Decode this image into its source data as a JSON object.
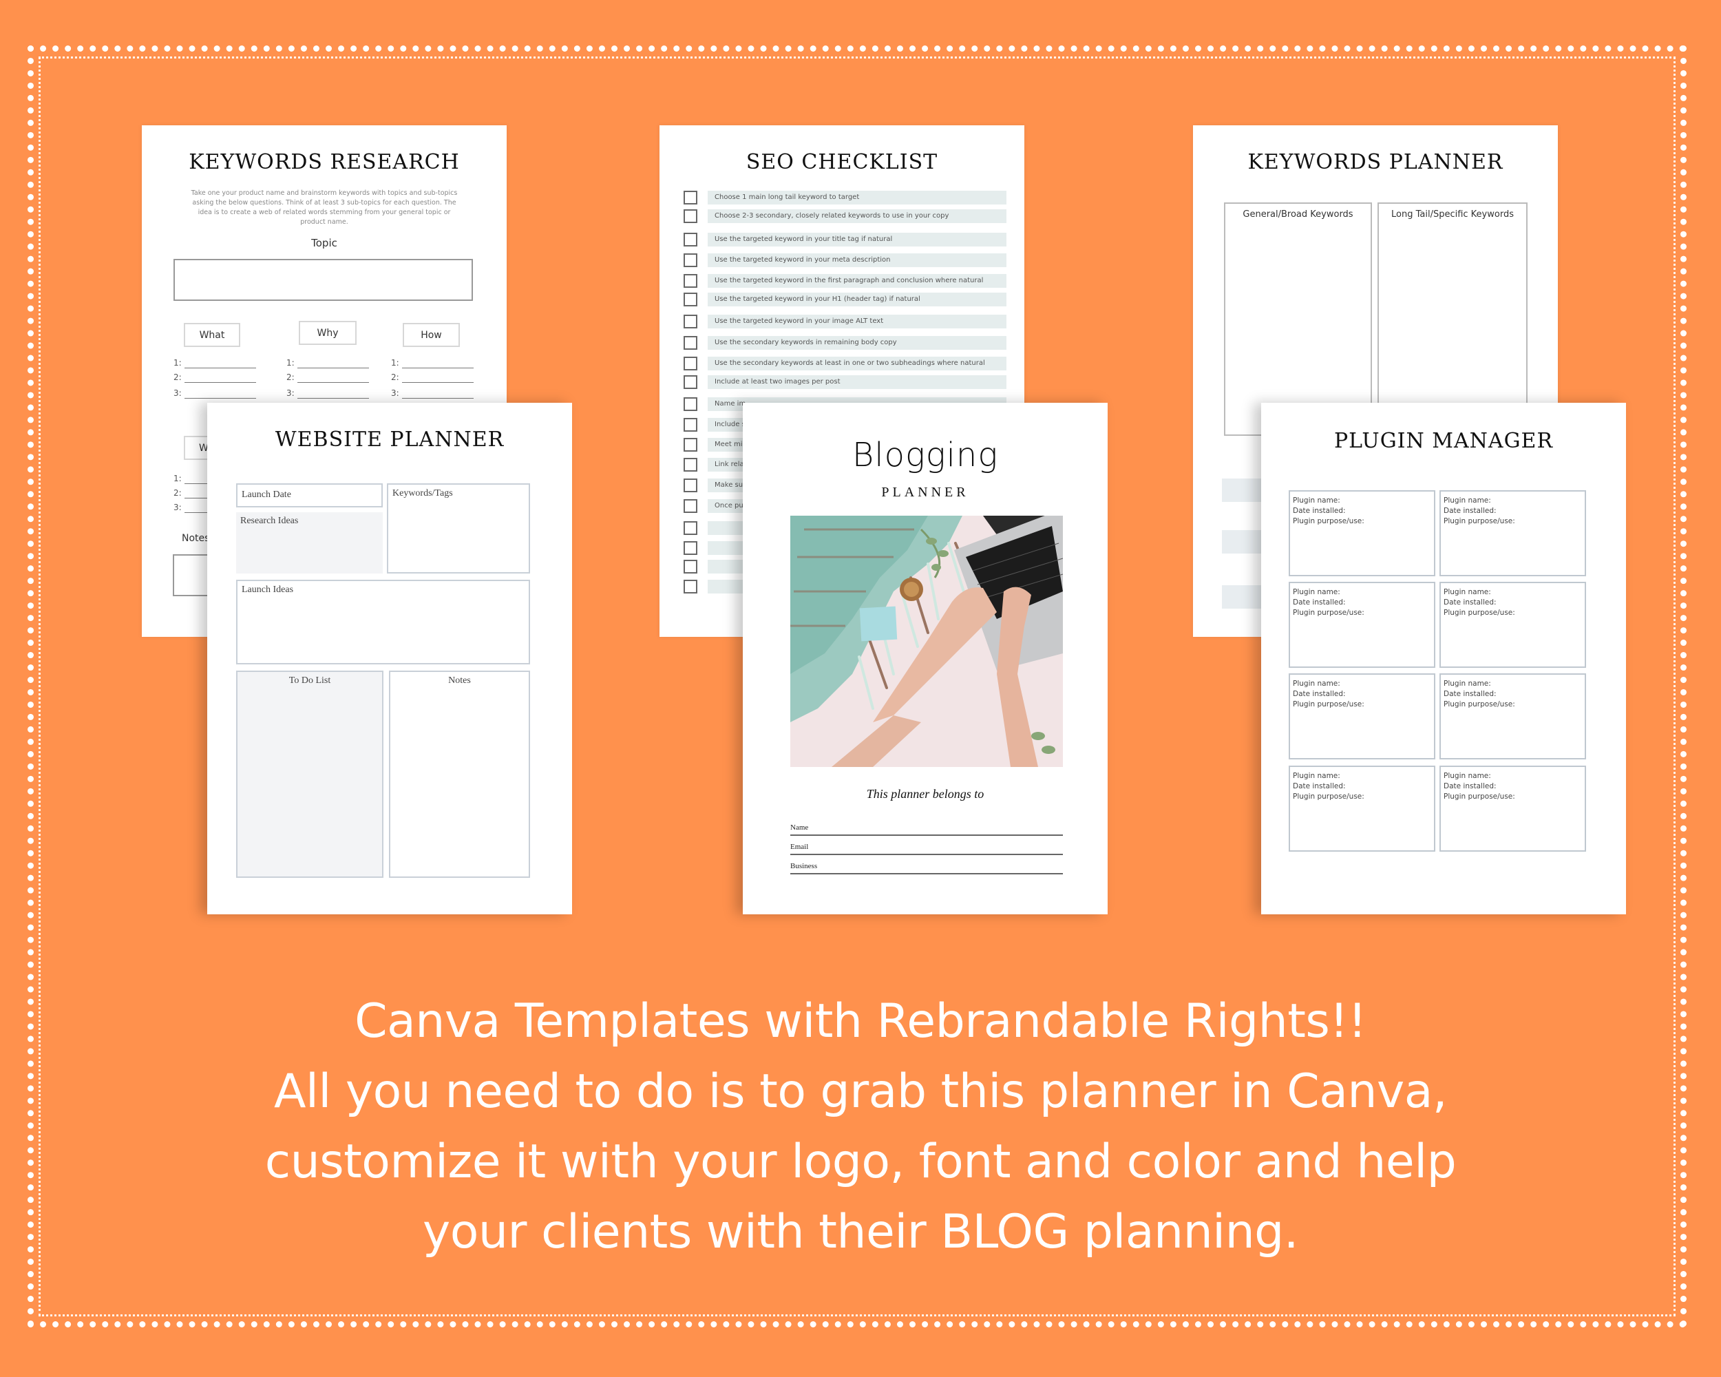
{
  "colors": {
    "background": "#ff914d",
    "page": "#ffffff",
    "checklist_bar": "#e5eded",
    "box_border": "#c9d0d8",
    "gray_fill": "#f3f4f6",
    "border_dots": "#ffffff"
  },
  "keywords_research": {
    "title": "KEYWORDS RESEARCH",
    "intro": "Take one your product name and brainstorm keywords with topics and sub-topics asking the below questions. Think of at least 3 sub-topics for each question. The idea is to create a web of related words stemming from your general topic or product name.",
    "topic_label": "Topic",
    "questions": [
      "What",
      "Why",
      "How"
    ],
    "second_row_partial": "W",
    "line_numbers": [
      "1:",
      "2:",
      "3:"
    ],
    "notes_label": "Notes"
  },
  "seo_checklist": {
    "title": "SEO CHECKLIST",
    "items": [
      "Choose 1 main long tail keyword to target",
      "Choose 2-3 secondary, closely related keywords to use in your copy",
      "Use the targeted keyword in your title tag if natural",
      "Use the targeted keyword in your meta description",
      "Use the targeted keyword in the first paragraph and conclusion where natural",
      "Use the targeted keyword in your H1 (header tag)  if natural",
      "Use the targeted keyword in your image ALT text",
      "Use the secondary keywords in remaining body copy",
      "Use the secondary keywords at least in one or two subheadings  where natural",
      "Include at least two images per post",
      "Name im",
      "Include s",
      "Meet mi",
      "Link rela",
      "Make su",
      "Once pu",
      "",
      "",
      "",
      ""
    ]
  },
  "keywords_planner": {
    "title": "KEYWORDS PLANNER",
    "columns": [
      "General/Broad Keywords",
      "Long Tail/Specific Keywords"
    ]
  },
  "website_planner": {
    "title": "WEBSITE PLANNER",
    "launch_date": "Launch Date",
    "keywords_tags": "Keywords/Tags",
    "research_ideas": "Research Ideas",
    "launch_ideas": "Launch Ideas",
    "todo": "To Do List",
    "notes": "Notes"
  },
  "blogging_cover": {
    "title": "Blogging",
    "subtitle": "PLANNER",
    "belongs_to": "This planner belongs to",
    "fields": [
      "Name",
      "Email",
      "Business"
    ]
  },
  "plugin_manager": {
    "title": "PLUGIN MANAGER",
    "fields": [
      "Plugin name:",
      "Date installed:",
      "Plugin purpose/use:"
    ],
    "card_count": 8
  },
  "footer": {
    "lines": [
      "Canva Templates with Rebrandable Rights!!",
      "All you need to do is to grab this planner in Canva,",
      "customize it with your logo, font and color and help",
      "your clients with their BLOG planning."
    ]
  }
}
